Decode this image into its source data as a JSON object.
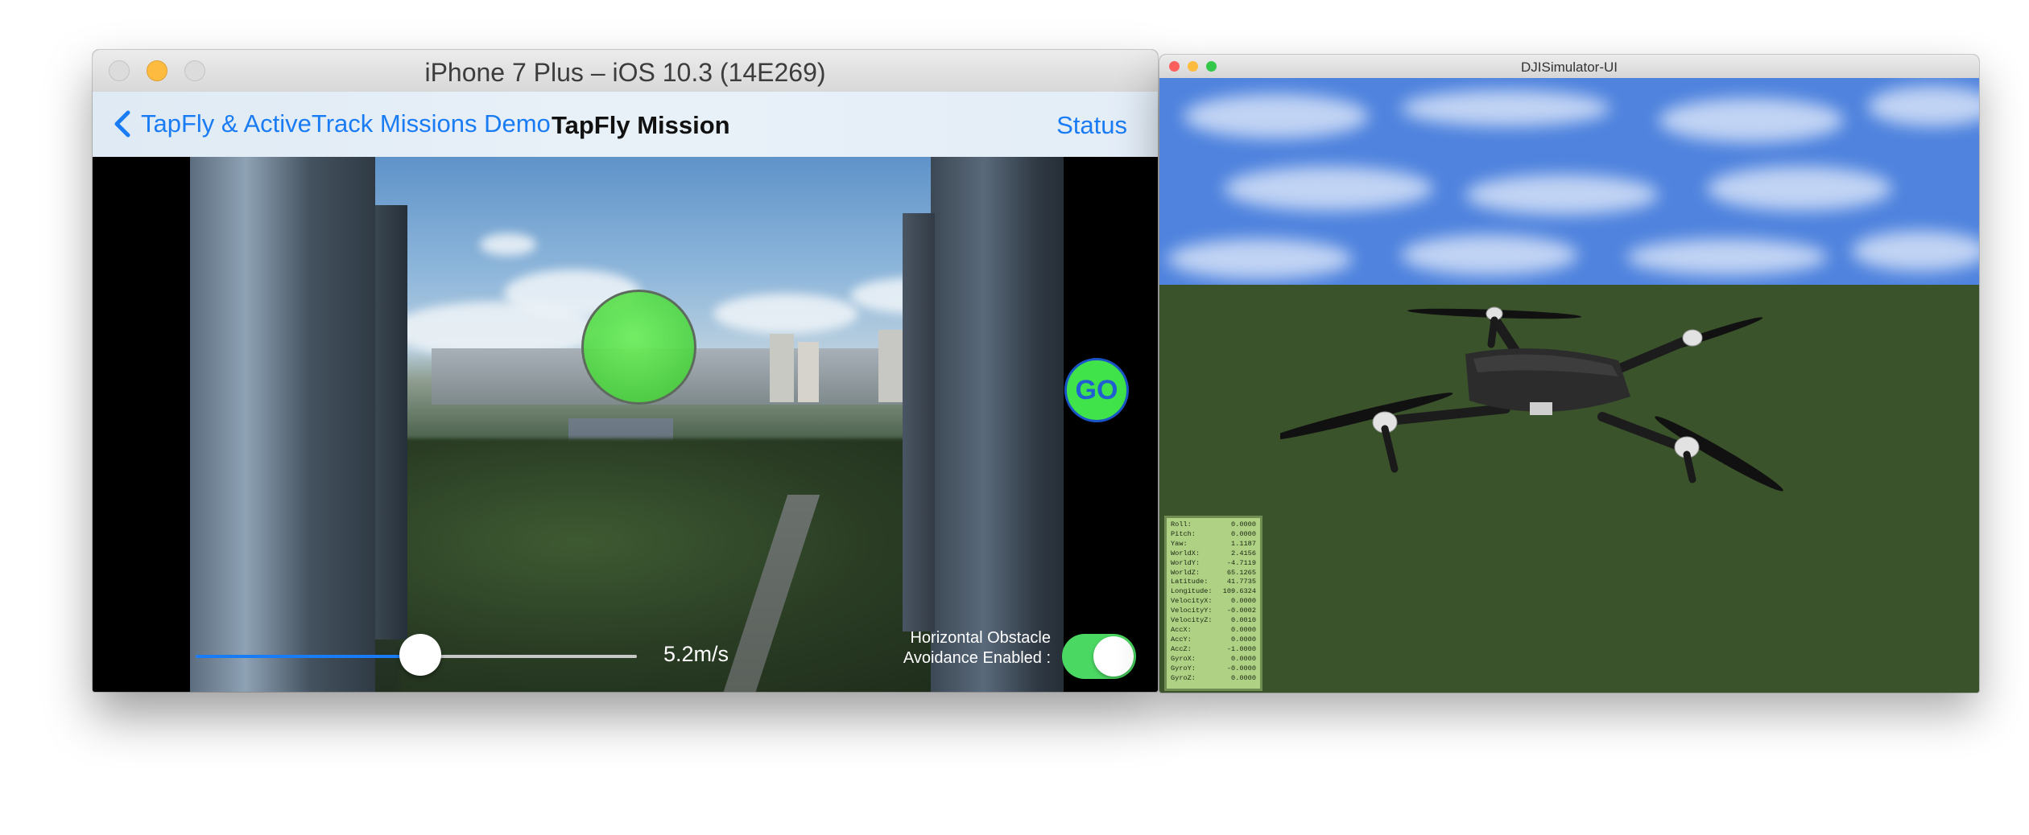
{
  "simulator": {
    "title": "iPhone 7 Plus – iOS 10.3 (14E269)",
    "navbar": {
      "back_label": "TapFly & ActiveTrack Missions Demo",
      "title": "TapFly Mission",
      "right_button": "Status"
    },
    "go_button": "GO",
    "speed": {
      "value": 0.51,
      "label": "5.2m/s"
    },
    "obstacle_avoidance": {
      "label_line1": "Horizontal Obstacle",
      "label_line2": "Avoidance Enabled :",
      "enabled": true
    },
    "colors": {
      "accent": "#1a7cf4",
      "target_circle": "#5ee84f",
      "go_button": "#41e34a",
      "toggle_on": "#4bd862"
    }
  },
  "dji_simulator": {
    "title": "DJISimulator-UI",
    "colors": {
      "sky": "#4f83de",
      "ground": "#3b532b",
      "telemetry_bg": "#b9dc8c"
    },
    "telemetry": [
      {
        "label": "Roll:",
        "value": "0.0000"
      },
      {
        "label": "Pitch:",
        "value": "0.0000"
      },
      {
        "label": "Yaw:",
        "value": "1.1187"
      },
      {
        "label": "WorldX:",
        "value": "2.4156"
      },
      {
        "label": "WorldY:",
        "value": "-4.7119"
      },
      {
        "label": "WorldZ:",
        "value": "65.1265"
      },
      {
        "label": "Latitude:",
        "value": "41.7735"
      },
      {
        "label": "Longitude:",
        "value": "109.6324"
      },
      {
        "label": "VelocityX:",
        "value": "0.0000"
      },
      {
        "label": "VelocityY:",
        "value": "-0.0002"
      },
      {
        "label": "VelocityZ:",
        "value": "0.0010"
      },
      {
        "label": "AccX:",
        "value": "0.0000"
      },
      {
        "label": "AccY:",
        "value": "0.0000"
      },
      {
        "label": "AccZ:",
        "value": "-1.0000"
      },
      {
        "label": "GyroX:",
        "value": "0.0000"
      },
      {
        "label": "GyroY:",
        "value": "-0.0000"
      },
      {
        "label": "GyroZ:",
        "value": "0.0000"
      }
    ]
  }
}
